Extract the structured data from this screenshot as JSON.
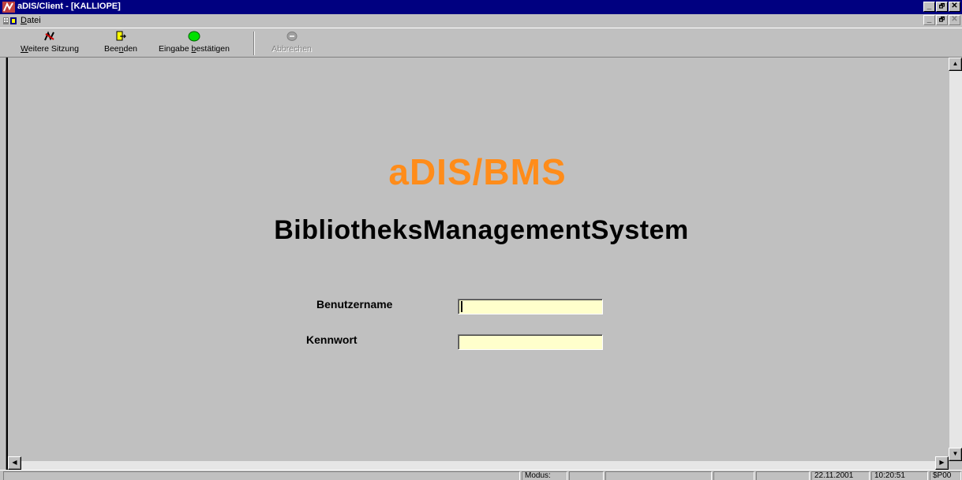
{
  "window": {
    "title": "aDIS/Client - [KALLIOPE]",
    "controls": [
      "_",
      "🗗",
      "✕"
    ]
  },
  "menubar": {
    "items": [
      {
        "accel": "D",
        "rest": "atei"
      }
    ],
    "mdi_controls": [
      "_",
      "🗗",
      "✕"
    ]
  },
  "toolbar": {
    "buttons": [
      {
        "label_pre": "",
        "label_accel": "W",
        "label_post": "eitere Sitzung",
        "icon": "new-session-icon",
        "enabled": true
      },
      {
        "label_pre": "Bee",
        "label_accel": "n",
        "label_post": "den",
        "icon": "exit-door-icon",
        "enabled": true
      },
      {
        "label_pre": "Eingabe ",
        "label_accel": "b",
        "label_post": "estätigen",
        "icon": "green-circle-icon",
        "enabled": true
      },
      {
        "label_pre": "Abbrechen",
        "label_accel": "",
        "label_post": "",
        "icon": "cancel-circle-icon",
        "enabled": false
      }
    ]
  },
  "content": {
    "brand": "aDIS/BMS",
    "subtitle": "BibliotheksManagementSystem",
    "username_label": "Benutzername",
    "username_value": "",
    "password_label": "Kennwort",
    "password_value": ""
  },
  "statusbar": {
    "modus_label": "Modus:",
    "date": "22.11.2001",
    "time": "10:20:51",
    "code": "$P00"
  },
  "colors": {
    "titlebar": "#000080",
    "brand": "#ff8c1a",
    "input_bg": "#ffffcc",
    "face": "#c0c0c0"
  }
}
